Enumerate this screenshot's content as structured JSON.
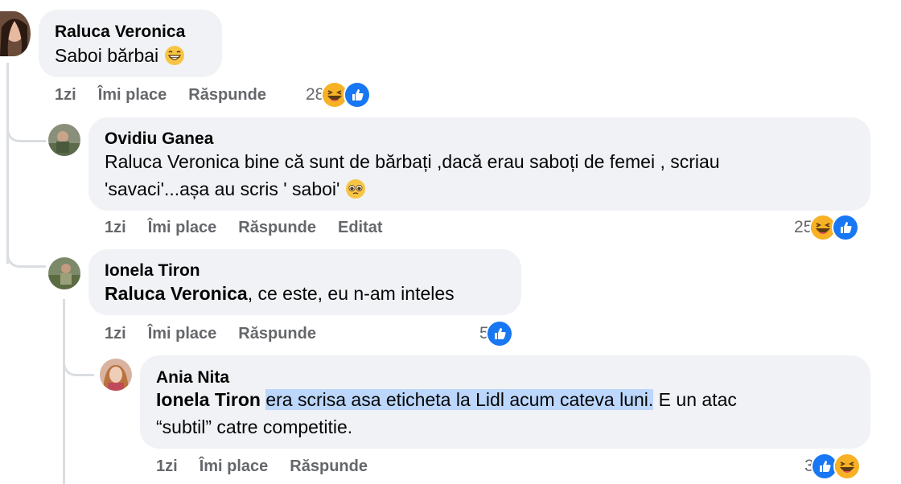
{
  "comments": [
    {
      "name": "Raluca Veronica",
      "text": "Saboi bărbai",
      "time": "1zi",
      "like": "Îmi place",
      "reply": "Răspunde",
      "count": "28"
    },
    {
      "name": "Ovidiu Ganea",
      "text_line1": "Raluca Veronica bine că sunt de bărbați ,dacă erau saboți de femei , scriau",
      "text_line2": "'savaci'...așa au scris ' saboi'",
      "time": "1zi",
      "like": "Îmi place",
      "reply": "Răspunde",
      "edited": "Editat",
      "count": "25"
    },
    {
      "name": "Ionela Tiron",
      "mention": "Raluca Veronica",
      "text": ", ce este, eu n-am inteles",
      "time": "1zi",
      "like": "Îmi place",
      "reply": "Răspunde",
      "count": "5"
    },
    {
      "name": "Ania Nita",
      "mention": "Ionela Tiron",
      "highlighted": "era scrisa asa eticheta la Lidl acum cateva luni.",
      "text_rest": " E un atac",
      "text_line2": "“subtil” catre competitie.",
      "time": "1zi",
      "like": "Îmi place",
      "reply": "Răspunde",
      "count": "3"
    }
  ],
  "colors": {
    "bubble": "#f0f2f5",
    "meta": "#65676b",
    "like_blue": "#1877f2",
    "haha_yellow": "#f7b125",
    "highlight": "#bcd7fb"
  }
}
